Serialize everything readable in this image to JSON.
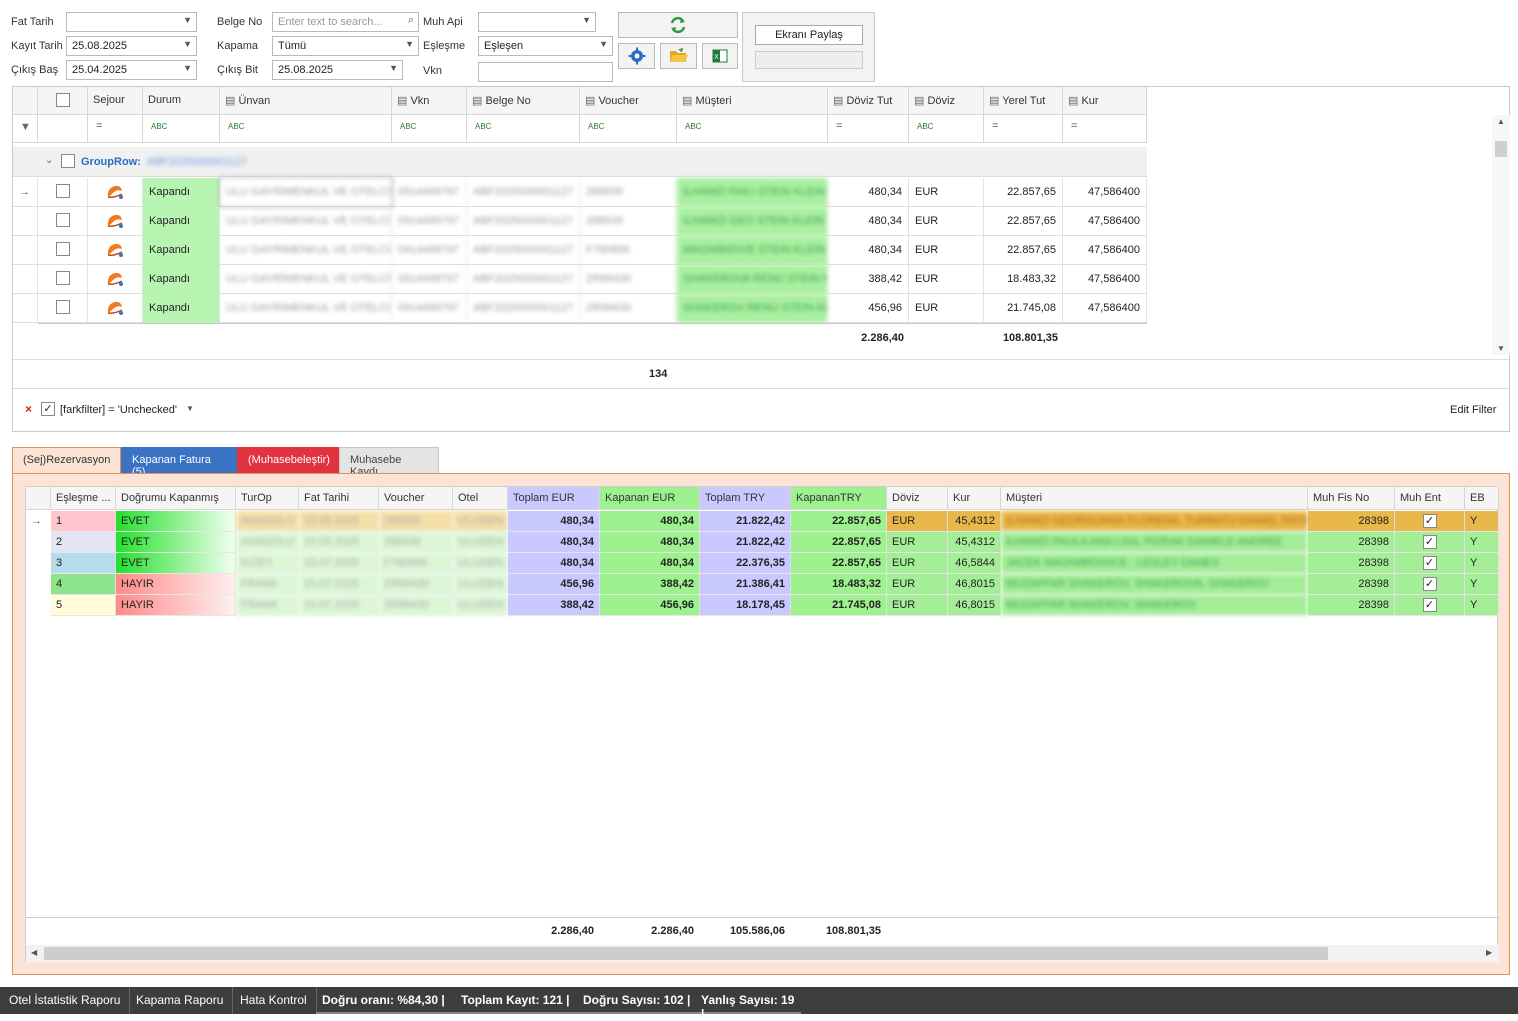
{
  "filters": {
    "fat_tarih_label": "Fat Tarih",
    "fat_tarih_value": "",
    "kayit_tarih_label": "Kayıt Tarih",
    "kayit_tarih_value": "25.08.2025",
    "cikis_bas_label": "Çıkış Baş",
    "cikis_bas_value": "25.04.2025",
    "belge_no_label": "Belge No",
    "belge_no_placeholder": "Enter text to search...",
    "kapama_label": "Kapama",
    "kapama_value": "Tümü",
    "cikis_bit_label": "Çıkış Bit",
    "cikis_bit_value": "25.08.2025",
    "muh_api_label": "Muh Api",
    "muh_api_value": "",
    "eslesme_label": "Eşleşme",
    "eslesme_value": "Eşleşen",
    "vkn_label": "Vkn",
    "vkn_value": ""
  },
  "share": {
    "button_label": "Ekranı Paylaş"
  },
  "top_grid": {
    "headers": [
      "Sejour",
      "Durum",
      "Ünvan",
      "Vkn",
      "Belge No",
      "Voucher",
      "Müşteri",
      "Döviz Tut",
      "Döviz",
      "Yerel Tut",
      "Kur"
    ],
    "group_row_label": "GroupRow:",
    "group_row_value": "ABF2025000001127",
    "rows": [
      {
        "durum": "Kapandı",
        "unvan": "ULU GAYRİMENKUL VE OTELCİ...",
        "vkn": "0914499797",
        "belge": "ABF2025000001127",
        "voucher": "288939",
        "musteri": "ILHAMZI FAILI STEIN KLEIN",
        "doviz_tut": "480,34",
        "doviz": "EUR",
        "yerel_tut": "22.857,65",
        "kur": "47,586400"
      },
      {
        "durum": "Kapandı",
        "unvan": "ULU GAYRİMENKUL VE OTELCİ...",
        "vkn": "0914499797",
        "belge": "ABF2025000001127",
        "voucher": "288939",
        "musteri": "ILHAMZI GEO STEIN KLEIN",
        "doviz_tut": "480,34",
        "doviz": "EUR",
        "yerel_tut": "22.857,65",
        "kur": "47,586400"
      },
      {
        "durum": "Kapandı",
        "unvan": "ULU GAYRİMENKUL VE OTELCİ...",
        "vkn": "0914499797",
        "belge": "ABF2025000001127",
        "voucher": "F780856",
        "musteri": "MAGNIBIDIVE STEIN KLEIN",
        "doviz_tut": "480,34",
        "doviz": "EUR",
        "yerel_tut": "22.857,65",
        "kur": "47,586400"
      },
      {
        "durum": "Kapandı",
        "unvan": "ULU GAYRİMENKUL VE OTELCİ...",
        "vkn": "0914499797",
        "belge": "ABF2025000001127",
        "voucher": "ZR99430",
        "musteri": "SHAKEROVA RENU STEIN K...",
        "doviz_tut": "388,42",
        "doviz": "EUR",
        "yerel_tut": "18.483,32",
        "kur": "47,586400"
      },
      {
        "durum": "Kapandı",
        "unvan": "ULU GAYRİMENKUL VE OTELCİ...",
        "vkn": "0914499797",
        "belge": "ABF2025000001127",
        "voucher": "ZR99430",
        "musteri": "SHAKEROV RENU STEIN KLEIN",
        "doviz_tut": "456,96",
        "doviz": "EUR",
        "yerel_tut": "21.745,08",
        "kur": "47,586400"
      }
    ],
    "sum_doviz_tut": "2.286,40",
    "sum_yerel_tut": "108.801,35",
    "row_count": "134",
    "filter_text": "[farkfilter] = 'Unchecked'",
    "edit_filter_label": "Edit Filter"
  },
  "tabs": [
    {
      "label": "(Sej)Rezervasyon"
    },
    {
      "label": "Kapanan Fatura (5)"
    },
    {
      "label": "(Muhasebeleştir)"
    },
    {
      "label": "Muhasebe Kaydı"
    }
  ],
  "bottom_grid": {
    "headers": [
      "Eşleşme ...",
      "Doğrumu Kapanmış",
      "TurOp",
      "Fat Tarihi",
      "Voucher",
      "Otel",
      "Toplam EUR",
      "Kapanan EUR",
      "Toplam TRY",
      "KapananTRY",
      "Döviz",
      "Kur",
      "Müşteri",
      "Muh Fis No",
      "Muh Ent",
      "EB"
    ],
    "rows": [
      {
        "es": "1",
        "dk": "EVET",
        "turop": "ANADOLU",
        "fat": "15.05.2025",
        "voucher": "288939",
        "otel": "ULUDEN",
        "te": "480,34",
        "ke": "480,34",
        "tt": "21.822,42",
        "kt": "22.857,65",
        "dv": "EUR",
        "kur": "45,4312",
        "mus": "ILHAMZI GEORGIJANA FLORENA, TURBATU DANIEL PATIE",
        "fis": "28398",
        "eb": "Y"
      },
      {
        "es": "2",
        "dk": "EVET",
        "turop": "ANADOLU",
        "fat": "15.05.2025",
        "voucher": "288939",
        "otel": "ULUDEN",
        "te": "480,34",
        "ke": "480,34",
        "tt": "21.822,42",
        "kt": "22.857,65",
        "dv": "EUR",
        "kur": "45,4312",
        "mus": "ILHAMZI PAULA ANA LISA, PIZRAK DANIELE ANDREE",
        "fis": "28398",
        "eb": "Y"
      },
      {
        "es": "3",
        "dk": "EVET",
        "turop": "IVZEY",
        "fat": "15.07.2025",
        "voucher": "F780856",
        "otel": "ULUDEN",
        "te": "480,34",
        "ke": "480,34",
        "tt": "22.376,35",
        "kt": "22.857,65",
        "dv": "EUR",
        "kur": "46,5844",
        "mus": "JACEK MAGNIBIDIVICE , LESLEY DANES",
        "fis": "28398",
        "eb": "Y"
      },
      {
        "es": "4",
        "dk": "HAYIR",
        "turop": "FRANK",
        "fat": "15.07.2025",
        "voucher": "ZR99430",
        "otel": "ULUDEN",
        "te": "456,96",
        "ke": "388,42",
        "tt": "21.386,41",
        "kt": "18.483,32",
        "dv": "EUR",
        "kur": "46,8015",
        "mus": "MUZAFFAR SHAKEROV, SHAKEROVA, SHAKEROV",
        "fis": "28398",
        "eb": "Y"
      },
      {
        "es": "5",
        "dk": "HAYIR",
        "turop": "FRANK",
        "fat": "15.07.2025",
        "voucher": "ZR99430",
        "otel": "ULUDEN",
        "te": "388,42",
        "ke": "456,96",
        "tt": "18.178,45",
        "kt": "21.745,08",
        "dv": "EUR",
        "kur": "46,8015",
        "mus": "MUZAFFAR SHAKEROV, SHAKEROV",
        "fis": "28398",
        "eb": "Y"
      }
    ],
    "sum_te": "2.286,40",
    "sum_ke": "2.286,40",
    "sum_tt": "105.586,06",
    "sum_kt": "108.801,35"
  },
  "status_bar": {
    "otel_istatistik": "Otel İstatistik Raporu",
    "kapama_raporu": "Kapama Raporu",
    "hata_kontrol": "Hata Kontrol",
    "dogru_orani": "Doğru oranı: %84,30 |",
    "toplam_kayit": "Toplam Kayıt: 121 |",
    "dogru_sayisi": "Doğru Sayısı: 102 |",
    "yanlis_sayisi": "Yanlış Sayısı: 19 |"
  },
  "colors": {
    "accent_blue": "#3c78d8",
    "tab_active_blue": "#3a73c4",
    "tab_red": "#e0323f",
    "green_cell": "#b6f5b0",
    "row_highlight": "#e9b84a",
    "status_bg": "#3d3d3d"
  }
}
